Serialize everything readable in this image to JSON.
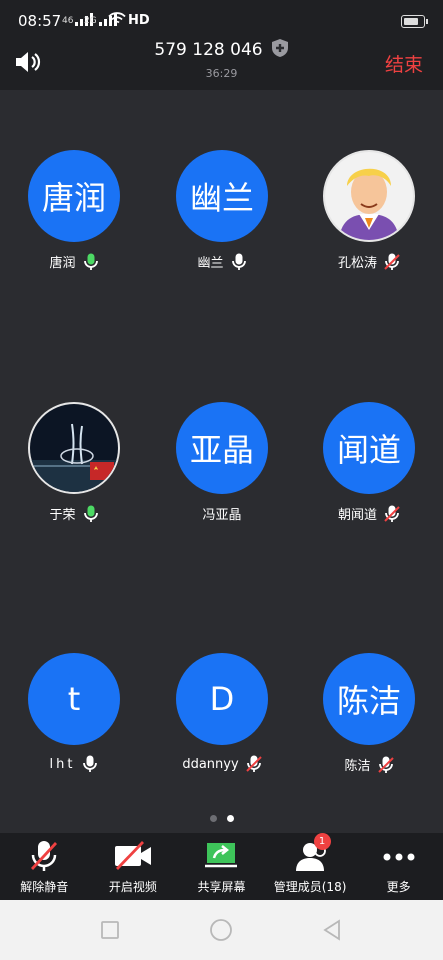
{
  "status_bar": {
    "time": "08:57",
    "signal1": "46",
    "signal2": "2G",
    "network": "HD"
  },
  "header": {
    "meeting_id": "579 128 046",
    "duration": "36:29",
    "end_label": "结束"
  },
  "participants": [
    {
      "avatar_text": "唐润",
      "name": "唐润",
      "mic": "on"
    },
    {
      "avatar_text": "幽兰",
      "name": "幽兰",
      "mic": "on-white"
    },
    {
      "avatar_text": "",
      "name": "孔松涛",
      "mic": "muted",
      "avatar_kind": "cartoon"
    },
    {
      "avatar_text": "",
      "name": "于荣",
      "mic": "on",
      "avatar_kind": "night-city"
    },
    {
      "avatar_text": "亚晶",
      "name": "冯亚晶",
      "mic": "none"
    },
    {
      "avatar_text": "闻道",
      "name": "朝闻道",
      "mic": "muted"
    },
    {
      "avatar_text": "t",
      "name": "lht",
      "mic": "on-white"
    },
    {
      "avatar_text": "D",
      "name": "ddannyy",
      "mic": "muted"
    },
    {
      "avatar_text": "陈洁",
      "name": "陈洁",
      "mic": "muted"
    }
  ],
  "toolbar": {
    "unmute": "解除静音",
    "start_video": "开启视频",
    "share_screen": "共享屏幕",
    "manage_members": "管理成员(18)",
    "more": "更多",
    "manage_badge": "1"
  },
  "colors": {
    "avatar_blue": "#1a73f5",
    "end_red": "#ef4141",
    "mic_green": "#4cd964"
  }
}
